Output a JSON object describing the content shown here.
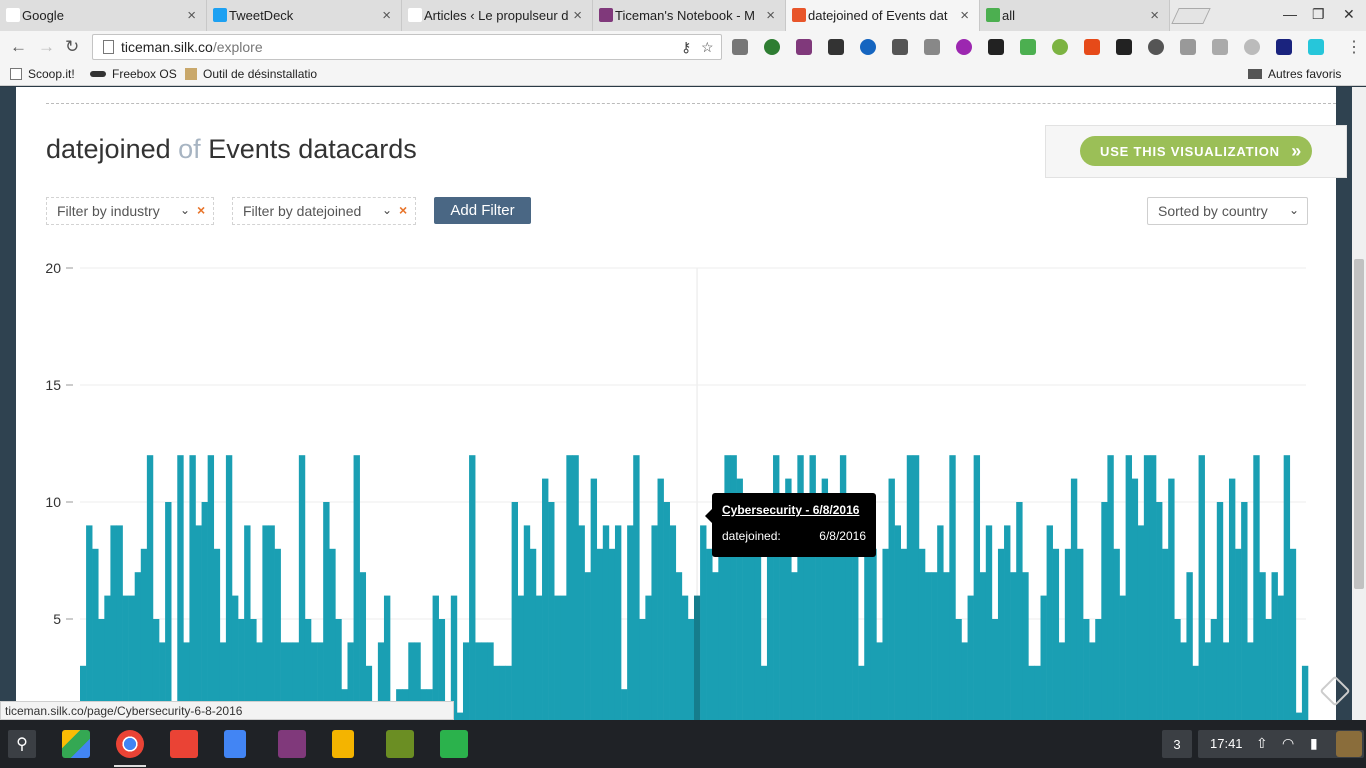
{
  "browser": {
    "tabs": [
      {
        "label": "Google",
        "color": "#ffffff"
      },
      {
        "label": "TweetDeck",
        "color": "#1da1f2"
      },
      {
        "label": "Articles ‹ Le propulseur d",
        "color": "#ffffff"
      },
      {
        "label": "Ticeman's Notebook - M",
        "color": "#80397b"
      },
      {
        "label": "datejoined of Events dat",
        "color": "#e8552a"
      },
      {
        "label": "all",
        "color": "#4caf50"
      }
    ],
    "url_host": "ticeman.silk.co",
    "url_path": "/explore",
    "bookmarks": [
      {
        "label": "Scoop.it!"
      },
      {
        "label": "Freebox OS"
      },
      {
        "label": "Outil de désinstallatio"
      }
    ],
    "other_bookmarks": "Autres favoris",
    "status_url": "ticeman.silk.co/page/Cybersecurity-6-8-2016"
  },
  "page": {
    "title_field": "datejoined",
    "title_of": "of",
    "title_collection": "Events datacards",
    "use_button": "USE THIS VISUALIZATION",
    "filters": [
      {
        "label": "Filter by industry"
      },
      {
        "label": "Filter by datejoined"
      }
    ],
    "add_filter": "Add Filter",
    "sort_label": "Sorted by country"
  },
  "tooltip": {
    "title": "Cybersecurity - 6/8/2016",
    "key": "datejoined:",
    "value": "6/8/2016"
  },
  "chart_data": {
    "type": "bar",
    "ylim": [
      0,
      20
    ],
    "yticks": [
      5,
      10,
      15,
      20
    ],
    "bar_color": "#1a9fb3",
    "highlight_color": "#157d8c",
    "highlight_index": 101,
    "values": [
      3,
      9,
      8,
      5,
      6,
      9,
      9,
      6,
      6,
      7,
      8,
      12,
      5,
      4,
      10,
      0,
      12,
      4,
      12,
      9,
      10,
      12,
      8,
      4,
      12,
      6,
      5,
      9,
      5,
      4,
      9,
      9,
      8,
      4,
      4,
      4,
      12,
      5,
      4,
      4,
      10,
      8,
      5,
      2,
      4,
      12,
      7,
      3,
      1,
      4,
      6,
      1,
      2,
      2,
      4,
      4,
      2,
      2,
      6,
      5,
      1,
      6,
      1,
      4,
      12,
      4,
      4,
      4,
      3,
      3,
      3,
      10,
      6,
      9,
      8,
      6,
      11,
      10,
      6,
      6,
      12,
      12,
      9,
      7,
      11,
      8,
      9,
      8,
      9,
      2,
      9,
      12,
      5,
      6,
      9,
      11,
      10,
      9,
      7,
      6,
      5,
      6,
      9,
      8,
      7,
      9,
      12,
      12,
      11,
      8,
      9,
      10,
      3,
      8,
      12,
      9,
      11,
      7,
      12,
      8,
      12,
      10,
      11,
      8,
      9,
      12,
      10,
      9,
      3,
      8,
      8,
      4,
      8,
      11,
      9,
      8,
      12,
      12,
      8,
      7,
      7,
      9,
      7,
      12,
      5,
      4,
      6,
      12,
      7,
      9,
      5,
      8,
      9,
      7,
      10,
      7,
      3,
      3,
      6,
      9,
      8,
      4,
      8,
      11,
      8,
      5,
      4,
      5,
      10,
      12,
      8,
      6,
      12,
      11,
      9,
      12,
      12,
      10,
      8,
      11,
      5,
      4,
      7,
      3,
      12,
      4,
      5,
      10,
      4,
      11,
      8,
      10,
      4,
      12,
      7,
      5,
      7,
      6,
      12,
      8,
      1,
      3
    ]
  },
  "shelf": {
    "notification_count": "3",
    "clock": "17:41"
  }
}
